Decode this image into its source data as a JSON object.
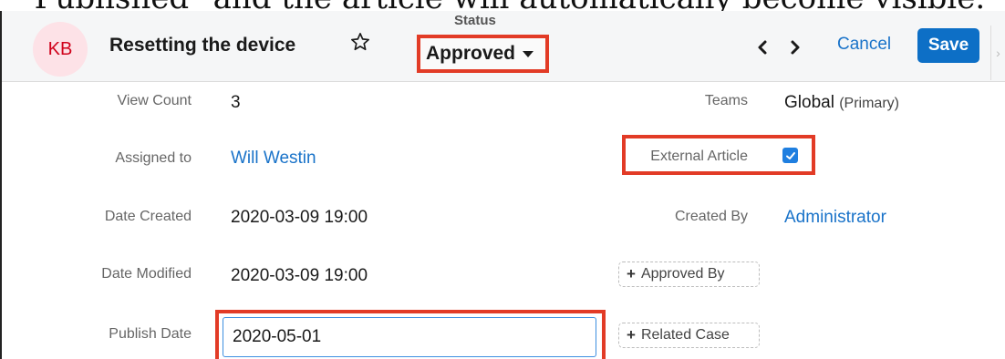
{
  "caption": "\"Published\" and the article will automatically become visible.",
  "header": {
    "avatar_initials": "KB",
    "record_title": "Resetting the device",
    "status_label": "Status",
    "status_value": "Approved",
    "cancel_label": "Cancel",
    "save_label": "Save",
    "scroll_glyph": "›"
  },
  "fields": {
    "view_count": {
      "label": "View Count",
      "value": "3"
    },
    "teams": {
      "label": "Teams",
      "value": "Global",
      "suffix": "(Primary)"
    },
    "assigned_to": {
      "label": "Assigned to",
      "value": "Will Westin"
    },
    "external_article": {
      "label": "External Article",
      "checked": true
    },
    "date_created": {
      "label": "Date Created",
      "value": "2020-03-09 19:00"
    },
    "created_by": {
      "label": "Created By",
      "value": "Administrator"
    },
    "date_modified": {
      "label": "Date Modified",
      "value": "2020-03-09 19:00"
    },
    "approved_by": {
      "label": "Approved By"
    },
    "publish_date": {
      "label": "Publish Date",
      "value": "2020-05-01"
    },
    "related_case": {
      "label": "Related Case"
    }
  },
  "colors": {
    "highlight": "#e23b26",
    "accent": "#0d6fc6",
    "link": "#1a73c9",
    "avatar_bg": "#fde2e7",
    "avatar_text": "#d0021b"
  },
  "icons": {
    "star": "star-icon",
    "caret": "caret-down-icon",
    "prev": "chevron-left-icon",
    "next": "chevron-right-icon",
    "check": "check-icon",
    "plus": "plus-icon"
  }
}
